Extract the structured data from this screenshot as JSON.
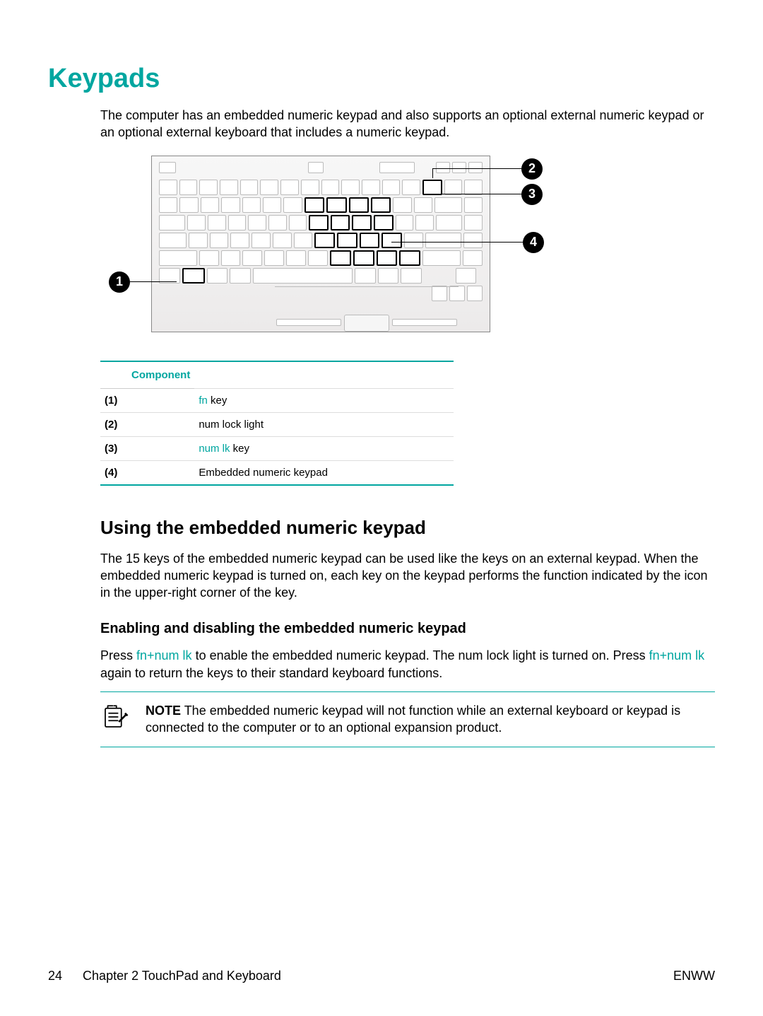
{
  "title": "Keypads",
  "intro": "The computer has an embedded numeric keypad and also supports an optional external numeric keypad or an optional external keyboard that includes a numeric keypad.",
  "callouts": {
    "1": "1",
    "2": "2",
    "3": "3",
    "4": "4"
  },
  "component_table": {
    "header": "Component",
    "rows": [
      {
        "num": "(1)",
        "text_prefix": "fn",
        "text_suffix": " key",
        "prefix_cyan": true
      },
      {
        "num": "(2)",
        "text_prefix": "",
        "text_suffix": "num lock light",
        "prefix_cyan": false
      },
      {
        "num": "(3)",
        "text_prefix": "num lk",
        "text_suffix": " key",
        "prefix_cyan": true
      },
      {
        "num": "(4)",
        "text_prefix": "",
        "text_suffix": "Embedded numeric keypad",
        "prefix_cyan": false
      }
    ]
  },
  "section2": {
    "heading": "Using the embedded numeric keypad",
    "para": "The 15 keys of the embedded numeric keypad can be used like the keys on an external keypad. When the embedded numeric keypad is turned on, each key on the keypad performs the function indicated by the icon in the upper-right corner of the key."
  },
  "section3": {
    "heading": "Enabling and disabling the embedded numeric keypad",
    "para_parts": {
      "p1a": "Press ",
      "p1b": "fn+num lk",
      "p1c": " to enable the embedded numeric keypad. The num lock light is turned on. Press ",
      "p1d": "fn+num lk",
      "p1e": " again to return the keys to their standard keyboard functions."
    }
  },
  "note": {
    "lead": "NOTE",
    "body": "   The embedded numeric keypad will not function while an external keyboard or keypad is connected to the computer or to an optional expansion product."
  },
  "footer": {
    "page": "24",
    "chapter": "Chapter 2   TouchPad and Keyboard",
    "right": "ENWW"
  }
}
